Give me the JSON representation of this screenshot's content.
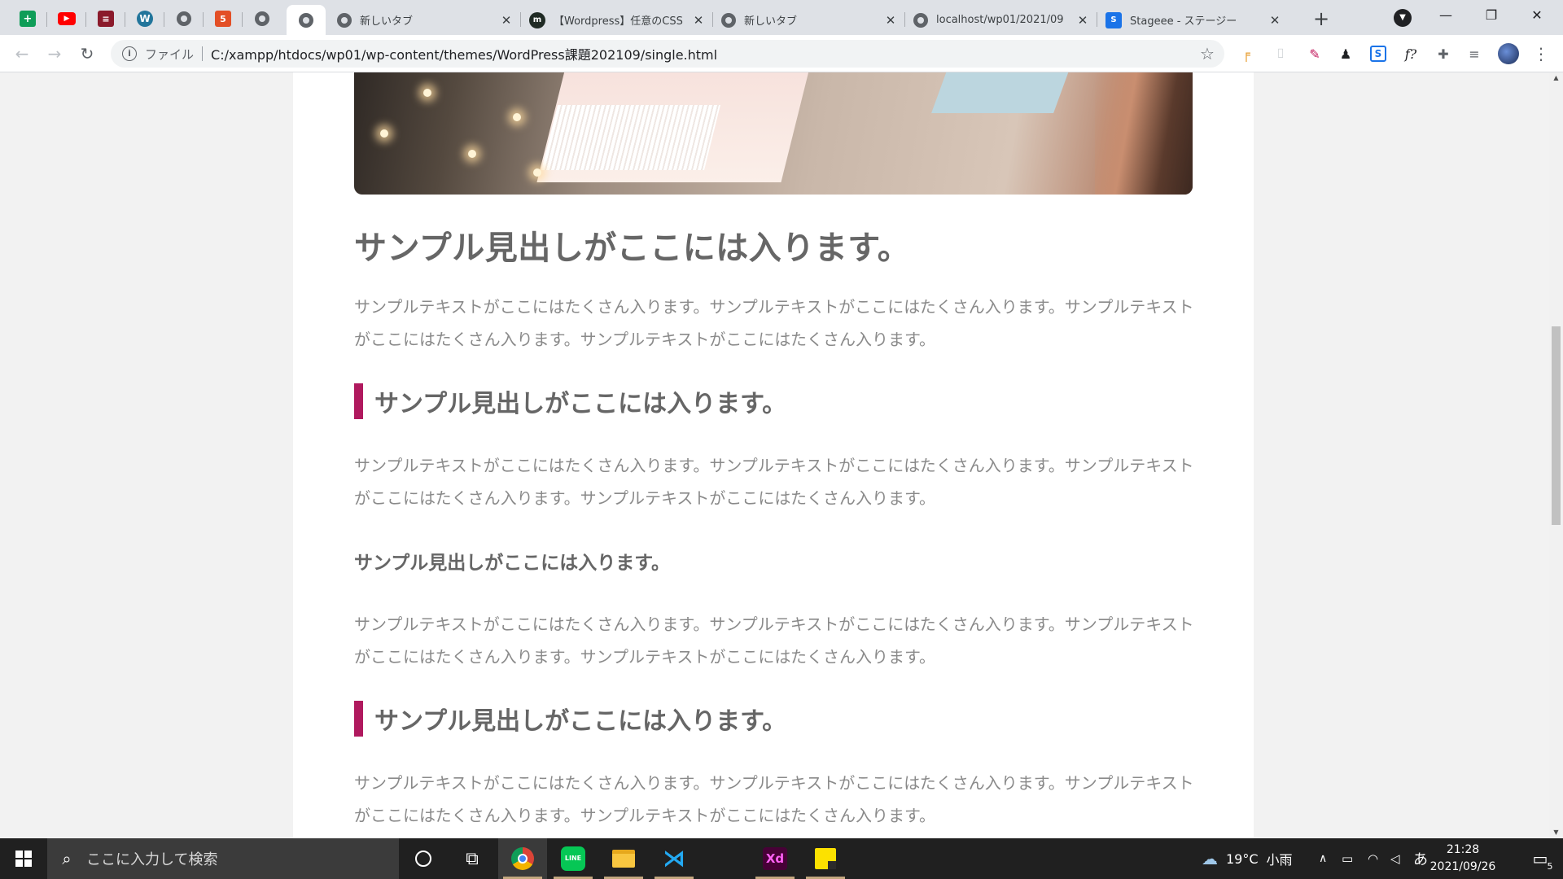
{
  "browser": {
    "pinned_tabs": [
      {
        "icon": "sheets-icon",
        "color": "#0f9d58"
      },
      {
        "icon": "youtube-icon",
        "color": "#ff0000"
      },
      {
        "icon": "bookmark-app-icon",
        "color": "#8b1a2b"
      },
      {
        "icon": "wordpress-icon",
        "color": "#21759b"
      },
      {
        "icon": "globe-icon",
        "color": "#5f6368"
      },
      {
        "icon": "html5-icon",
        "color": "#e34f26"
      },
      {
        "icon": "globe-icon",
        "color": "#5f6368"
      },
      {
        "icon": "globe-icon",
        "color": "#5f6368"
      }
    ],
    "tabs": [
      {
        "title": "新しいタブ",
        "icon": "globe-icon"
      },
      {
        "title": "【Wordpress】任意のCSS",
        "icon": "blog-icon"
      },
      {
        "title": "新しいタブ",
        "icon": "globe-icon"
      },
      {
        "title": "localhost/wp01/2021/09",
        "icon": "globe-icon"
      },
      {
        "title": "Stageee - ステージー",
        "icon": "stageee-icon"
      }
    ],
    "tab_close_glyph": "✕",
    "new_tab_glyph": "+",
    "window_controls": {
      "minimize": "—",
      "restore": "❐",
      "close": "✕"
    }
  },
  "toolbar": {
    "back": "←",
    "forward": "→",
    "reload": "↻",
    "address": {
      "scheme_label": "ファイル",
      "url": "C:/xampp/htdocs/wp01/wp-content/themes/WordPress課題202109/single.html"
    },
    "star": "☆",
    "extensions": [
      "pen-icon",
      "bookmark-icon",
      "color-picker-icon",
      "hat-icon",
      "stageee-icon",
      "formula-icon",
      "puzzle-icon",
      "media-icon"
    ],
    "formula_label": "f?",
    "menu": "⋮"
  },
  "article": {
    "h1": "サンプル見出しがここには入ります。",
    "paragraph_1": "サンプルテキストがここにはたくさん入ります。サンプルテキストがここにはたくさん入ります。サンプルテキストがここにはたくさん入ります。サンプルテキストがここにはたくさん入ります。",
    "h2_first": "サンプル見出しがここには入ります。",
    "paragraph_2": "サンプルテキストがここにはたくさん入ります。サンプルテキストがここにはたくさん入ります。サンプルテキストがここにはたくさん入ります。サンプルテキストがここにはたくさん入ります。",
    "h3": "サンプル見出しがここには入ります。",
    "paragraph_3": "サンプルテキストがここにはたくさん入ります。サンプルテキストがここにはたくさん入ります。サンプルテキストがここにはたくさん入ります。サンプルテキストがここにはたくさん入ります。",
    "h2_second": "サンプル見出しがここには入ります。",
    "paragraph_4": "サンプルテキストがここにはたくさん入ります。サンプルテキストがここにはたくさん入ります。サンプルテキストがここにはたくさん入ります。サンプルテキストがここにはたくさん入ります。",
    "accent_color": "#b0195e",
    "heading_color": "#666666",
    "text_color": "#8a8a8a"
  },
  "taskbar": {
    "search_placeholder": "ここに入力して検索",
    "apps": [
      "cortana-icon",
      "task-view-icon",
      "chrome-icon",
      "line-icon",
      "file-explorer-icon",
      "vscode-icon",
      "adobe-xd-icon",
      "sticky-notes-icon"
    ],
    "line_label": "LINE",
    "xd_label": "Xd",
    "weather": {
      "temp": "19°C",
      "condition": "小雨"
    },
    "ime": "あ",
    "time": "21:28",
    "date": "2021/09/26",
    "notification_count": "5"
  }
}
